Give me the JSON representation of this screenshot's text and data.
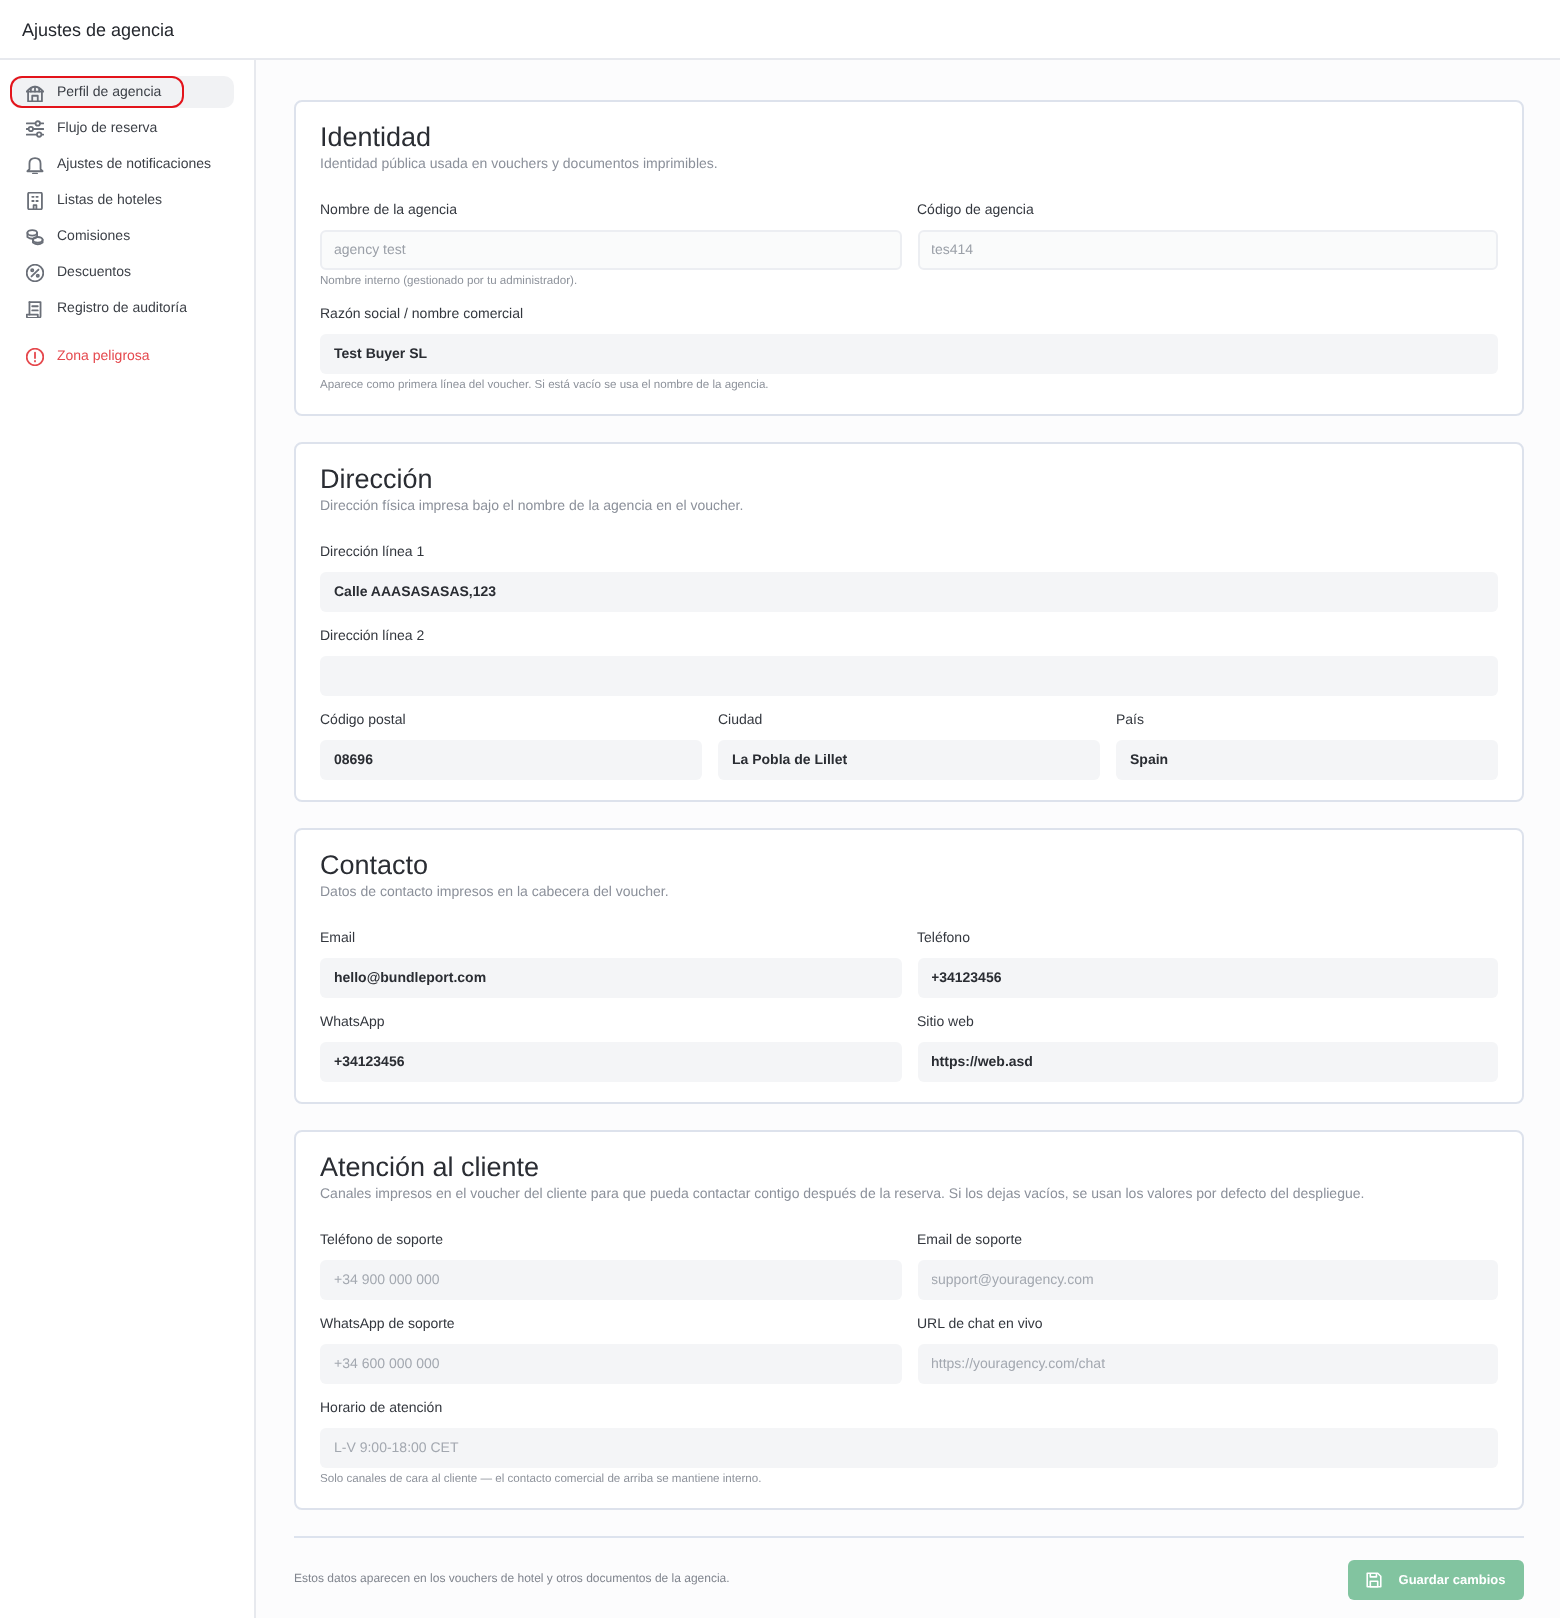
{
  "header": {
    "title": "Ajustes de agencia"
  },
  "sidebar": {
    "items": [
      {
        "label": "Perfil de agencia",
        "selected": true,
        "circled": true,
        "danger": false
      },
      {
        "label": "Flujo de reserva",
        "selected": false,
        "circled": false,
        "danger": false
      },
      {
        "label": "Ajustes de notificaciones",
        "selected": false,
        "circled": false,
        "danger": false
      },
      {
        "label": "Listas de hoteles",
        "selected": false,
        "circled": false,
        "danger": false
      },
      {
        "label": "Comisiones",
        "selected": false,
        "circled": false,
        "danger": false
      },
      {
        "label": "Descuentos",
        "selected": false,
        "circled": false,
        "danger": false
      },
      {
        "label": "Registro de auditoría",
        "selected": false,
        "circled": false,
        "danger": false
      },
      {
        "label": "Zona peligrosa",
        "selected": false,
        "circled": false,
        "danger": true
      }
    ]
  },
  "sections": [
    {
      "title": "Identidad",
      "subtitle": "Identidad pública usada en vouchers y documentos imprimibles.",
      "rows": [
        [
          {
            "label": "Nombre de la agencia",
            "value": "agency test",
            "disabled": true,
            "hint": "Nombre interno (gestionado por tu administrador)."
          },
          {
            "label": "Código de agencia",
            "value": "tes414",
            "disabled": true
          }
        ],
        [
          {
            "label": "Razón social / nombre comercial",
            "value": "Test Buyer SL",
            "disabled": false,
            "hint": "Aparece como primera línea del voucher. Si está vacío se usa el nombre de la agencia."
          }
        ]
      ]
    },
    {
      "title": "Dirección",
      "subtitle": "Dirección física impresa bajo el nombre de la agencia en el voucher.",
      "rows": [
        [
          {
            "label": "Dirección línea 1",
            "value": "Calle AAASASASAS,123",
            "disabled": false
          }
        ],
        [
          {
            "label": "Dirección línea 2"
          }
        ],
        [
          {
            "label": "Código postal",
            "value": "08696",
            "disabled": false
          },
          {
            "label": "Ciudad",
            "value": "La Pobla de Lillet",
            "disabled": false
          },
          {
            "label": "País",
            "value": "Spain",
            "disabled": false
          }
        ]
      ]
    },
    {
      "title": "Contacto",
      "subtitle": "Datos de contacto impresos en la cabecera del voucher.",
      "rows": [
        [
          {
            "label": "Email",
            "value": "hello@bundleport.com",
            "disabled": false
          },
          {
            "label": "Teléfono",
            "value": "+34123456",
            "disabled": false
          }
        ],
        [
          {
            "label": "WhatsApp",
            "value": "+34123456",
            "disabled": false
          },
          {
            "label": "Sitio web",
            "value": "https://web.asd",
            "disabled": false
          }
        ]
      ]
    },
    {
      "title": "Atención al cliente",
      "subtitle": "Canales impresos en el voucher del cliente para que pueda contactar contigo después de la reserva. Si los dejas vacíos, se usan los valores por defecto del despliegue.",
      "rows": [
        [
          {
            "label": "Teléfono de soporte",
            "placeholder": "+34 900 000 000",
            "disabled": false
          },
          {
            "label": "Email de soporte",
            "placeholder": "support@youragency.com",
            "disabled": false
          }
        ],
        [
          {
            "label": "WhatsApp de soporte",
            "placeholder": "+34 600 000 000",
            "disabled": false
          },
          {
            "label": "URL de chat en vivo",
            "placeholder": "https://youragency.com/chat",
            "disabled": false
          }
        ],
        [
          {
            "label": "Horario de atención",
            "placeholder": "L-V 9:00-18:00 CET",
            "disabled": false,
            "hint": "Solo canales de cara al cliente — el contacto comercial de arriba se mantiene interno."
          }
        ]
      ]
    }
  ],
  "footer": {
    "note": "Estos datos aparecen en los vouchers de hotel y otros documentos de la agencia.",
    "save_button": {
      "label": "Guardar cambios",
      "disabled": true
    }
  }
}
